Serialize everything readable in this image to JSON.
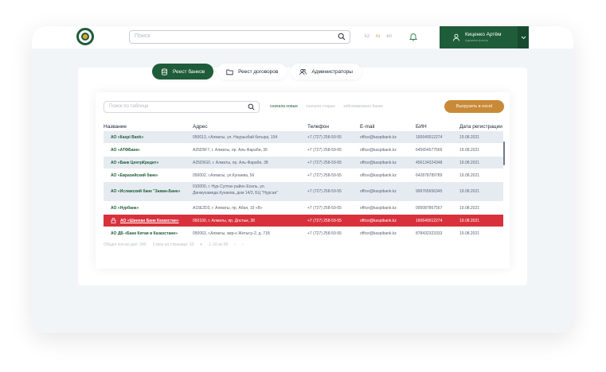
{
  "header": {
    "search_placeholder": "Поиск",
    "langs": [
      {
        "label": "kz",
        "active": false
      },
      {
        "label": "ru",
        "active": true
      },
      {
        "label": "en",
        "active": false
      }
    ],
    "user": {
      "name": "Киценко Артём",
      "subtitle": "Администратор"
    }
  },
  "tabs": [
    {
      "label": "Реест банков",
      "icon": "database-icon",
      "active": true
    },
    {
      "label": "Реест договоров",
      "icon": "folder-icon",
      "active": false
    },
    {
      "label": "Администраторы",
      "icon": "users-icon",
      "active": false
    }
  ],
  "table_toolbar": {
    "search_placeholder": "Поиск по таблице",
    "filters": [
      {
        "label": "сначала новые",
        "active": true
      },
      {
        "label": "сначала старые",
        "active": false
      },
      {
        "label": "заблокировано банки",
        "active": false
      }
    ],
    "export_label": "Выгрузить в excel"
  },
  "table": {
    "columns": [
      "Название",
      "Адрес",
      "Телефон",
      "E-mail",
      "БИН",
      "Дата регистрации"
    ],
    "rows": [
      {
        "name": "АО «Каspi Bank»",
        "address": "050013, г.Алматы, ул. Наурызбай батыра, 154",
        "address2": "",
        "phone": "+7 (727) 258-59-55",
        "email": "office@kaspibank.kz",
        "bin": "160640012274",
        "date": "19.08.2021",
        "style": "alt"
      },
      {
        "name": "АО «АТФБанк»",
        "address": "A25D5F7, г. Алматы, пр. Аль-Фараби, 36",
        "address2": "",
        "phone": "+7 (727) 258-59-55",
        "email": "office@kaspibank.kz",
        "bin": "645654577566",
        "date": "19.08.2021",
        "style": "plain"
      },
      {
        "name": "АО «Банк ЦентрКредит»",
        "address": "A25D5G0, г. Алматы, пр. Аль-Фараби, 38",
        "address2": "",
        "phone": "+7 (727) 258-59-55",
        "email": "office@kaspibank.kz",
        "bin": "456134324348",
        "date": "19.08.2021",
        "style": "alt"
      },
      {
        "name": "АО «Евразийский банк»",
        "address": "050002, г.Алматы, ул.Кунаева, 56",
        "address2": "",
        "phone": "+7 (727) 258-59-55",
        "email": "office@kaspibank.kz",
        "bin": "642878789789",
        "date": "19.08.2021",
        "style": "plain"
      },
      {
        "name": "АО «Исламский банк \"Заман-Банк»",
        "address": "010000, г. Нур-Султан район Есиль, ул.",
        "address2": "Динмухамеда Кунаева, дом 14/3, БЦ \"Нурсая\"",
        "phone": "+7 (727) 258-59-55",
        "email": "office@kaspibank.kz",
        "bin": "999765656345",
        "date": "19.08.2021",
        "style": "alt"
      },
      {
        "name": "АО «Нурбанк»",
        "address": "A15E2D3, г. Алматы, пр. Абая, 10 «В»",
        "address2": "",
        "phone": "+7 (727) 258-59-55",
        "email": "office@kaspibank.kz",
        "bin": "000087867567",
        "date": "19.08.2021",
        "style": "plain"
      },
      {
        "name": "АО «Шинхан Банк Казахстан»",
        "address": "050100, г. Алматы, пр. Достык, 38",
        "address2": "",
        "phone": "+7 (727) 258-59-55",
        "email": "office@kaspibank.kz",
        "bin": "160640012274",
        "date": "19.08.2021",
        "style": "danger"
      },
      {
        "name": "АО ДБ «Банк Китая в Казахстане»",
        "address": "050063, г.Алматы, мкр-н Жетысу-2, д. 71Б",
        "address2": "",
        "phone": "+7 (727) 258-59-55",
        "email": "office@kaspibank.kz",
        "bin": "878432323333",
        "date": "19.08.2021",
        "style": "plain"
      }
    ]
  },
  "footer_info": {
    "total": "Общее кол-во дел: 345",
    "per_page_label": "Строк на странице: 10",
    "range": "1–10 из 90"
  },
  "colors": {
    "brand": "#1f5c3a",
    "accent": "#c98a37",
    "danger": "#d8313c"
  }
}
